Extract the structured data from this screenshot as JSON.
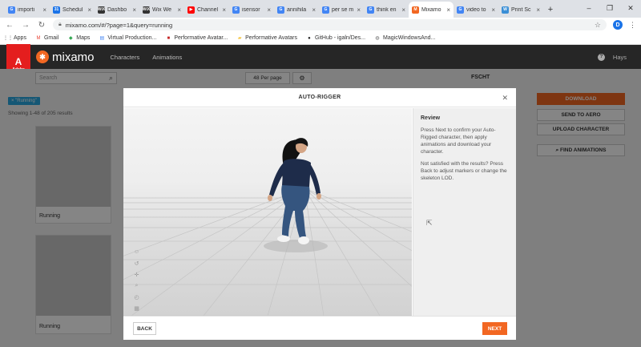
{
  "browser": {
    "tabs": [
      {
        "title": "importi",
        "favicon": "G",
        "color": "#4285f4",
        "active": false
      },
      {
        "title": "Schedul",
        "favicon": "31",
        "color": "#1a73e8",
        "active": false
      },
      {
        "title": "Dashbo",
        "favicon": "WiX",
        "color": "#333333",
        "active": false
      },
      {
        "title": "Wix We",
        "favicon": "WiX",
        "color": "#333333",
        "active": false
      },
      {
        "title": "Channel",
        "favicon": "▶",
        "color": "#ff0000",
        "active": false
      },
      {
        "title": "isensor",
        "favicon": "G",
        "color": "#4285f4",
        "active": false
      },
      {
        "title": "annihila",
        "favicon": "G",
        "color": "#4285f4",
        "active": false
      },
      {
        "title": "per se m",
        "favicon": "G",
        "color": "#4285f4",
        "active": false
      },
      {
        "title": "think en",
        "favicon": "G",
        "color": "#4285f4",
        "active": false
      },
      {
        "title": "Mixamo",
        "favicon": "M",
        "color": "#f26722",
        "active": true
      },
      {
        "title": "video to",
        "favicon": "G",
        "color": "#4285f4",
        "active": false
      },
      {
        "title": "Print Sc",
        "favicon": "W",
        "color": "#3b8fd6",
        "active": false
      }
    ],
    "new_tab": "+",
    "window_controls": [
      "–",
      "❐",
      "✕"
    ],
    "url": "mixamo.com/#/?page=1&query=running",
    "profile_initial": "D",
    "bookmarks": [
      {
        "label": "Apps",
        "icon": "apps-grid-icon"
      },
      {
        "label": "Gmail",
        "icon": "gmail-icon"
      },
      {
        "label": "Maps",
        "icon": "maps-icon"
      },
      {
        "label": "Virtual Production...",
        "icon": "docs-icon"
      },
      {
        "label": "Performative Avatar...",
        "icon": "red-square-icon"
      },
      {
        "label": "Performative Avatars",
        "icon": "folder-icon"
      },
      {
        "label": "GitHub - igaln/Des...",
        "icon": "github-icon"
      },
      {
        "label": "MagicWindowsAnd...",
        "icon": "globe-icon"
      }
    ]
  },
  "mixamo": {
    "adobe_label": "Adobe",
    "logo_text": "mixamo",
    "nav": [
      "Characters",
      "Animations"
    ],
    "user": "Hays",
    "search_placeholder": "Search",
    "per_page": "48 Per page",
    "character_name": "FSCHT",
    "tag": "\"Running\"",
    "showing": "Showing 1-48 of 205 results",
    "cards": [
      {
        "label": "Running"
      },
      {
        "label": "Running"
      }
    ],
    "right_panel": {
      "download": "DOWNLOAD",
      "send_to_aero": "SEND TO AERO",
      "upload_character": "UPLOAD CHARACTER",
      "find_animations": "FIND ANIMATIONS"
    }
  },
  "modal": {
    "title": "AUTO-RIGGER",
    "review_heading": "Review",
    "review_p1": "Press Next to confirm your Auto-Rigged character, then apply animations and download your character.",
    "review_p2": "Not satisfied with the results? Press Back to adjust markers or change the skeleton LOD.",
    "back_label": "BACK",
    "next_label": "NEXT"
  },
  "colors": {
    "accent": "#f26722",
    "header_bg": "#262626",
    "tag_bg": "#29a8e0"
  }
}
